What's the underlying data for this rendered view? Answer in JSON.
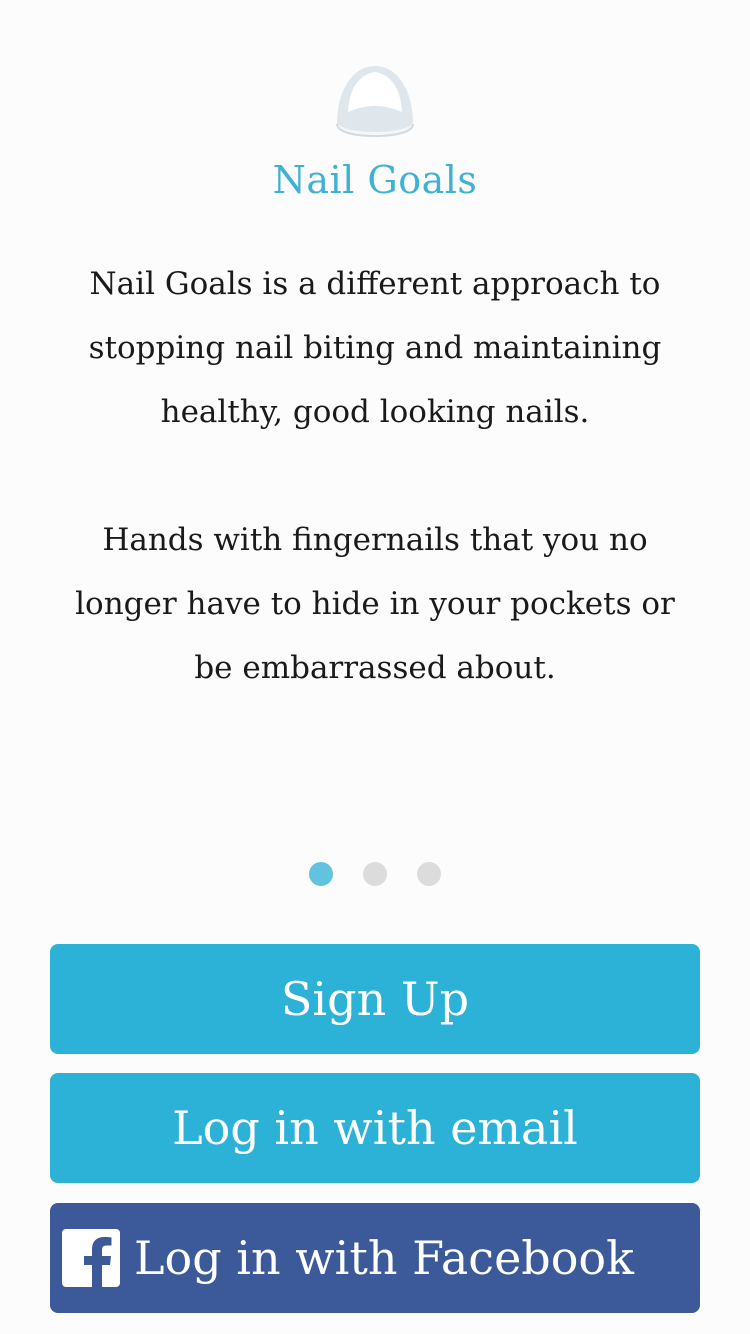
{
  "app": {
    "name": "Nail Goals",
    "logo_icon": "nail-dome-icon"
  },
  "intro": {
    "paragraph_1": "Nail Goals is a different approach to stopping nail biting and maintaining healthy, good looking nails.",
    "paragraph_2": "Hands with fingernails that you no longer have to hide in your pockets or be embarrassed about."
  },
  "pager": {
    "total": 3,
    "active_index": 0
  },
  "buttons": {
    "signup_label": "Sign Up",
    "email_login_label": "Log in with email",
    "facebook_login_label": "Log in with Facebook",
    "facebook_icon": "facebook-icon"
  },
  "colors": {
    "accent": "#2cb2d7",
    "title": "#3fb2d4",
    "facebook": "#3c5a99",
    "dot_active": "#62c3df",
    "dot_inactive": "#dcdcdc"
  }
}
